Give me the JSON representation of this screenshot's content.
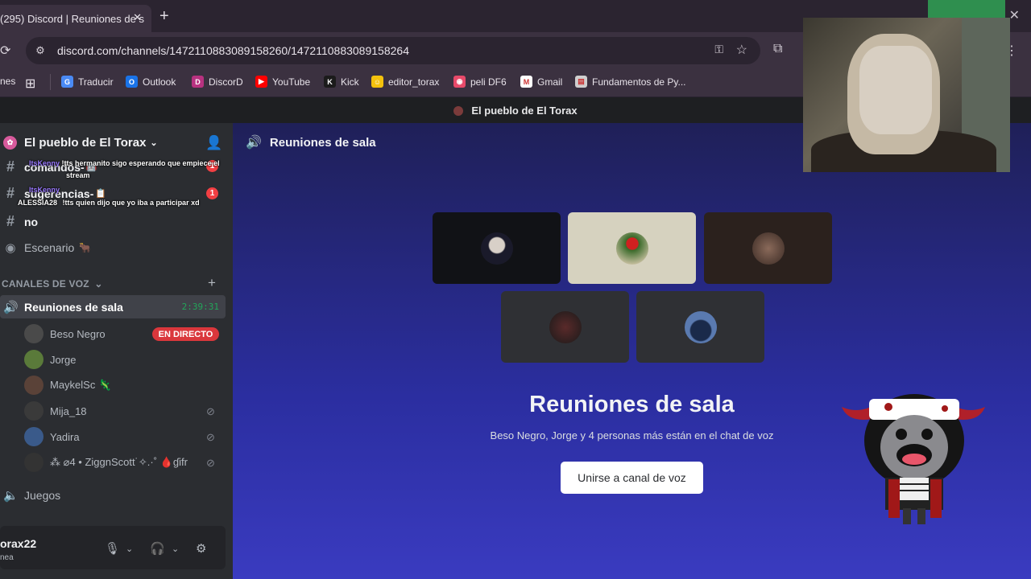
{
  "browser": {
    "tab_title": "(295) Discord | Reuniones de s",
    "tab_close": "✕",
    "new_tab": "+",
    "url": "discord.com/channels/1472110883089158260/1472110883089158264",
    "bookmarks": [
      {
        "label": "Traducir",
        "color": "#4a8af4",
        "glyph": "G"
      },
      {
        "label": "Outlook",
        "color": "#1a73e8",
        "glyph": "O"
      },
      {
        "label": "DiscorD",
        "color": "#b83280",
        "glyph": "D"
      },
      {
        "label": "YouTube",
        "color": "#ff0000",
        "glyph": "▶"
      },
      {
        "label": "Kick",
        "color": "#1b1b1b",
        "glyph": "K"
      },
      {
        "label": "editor_torax",
        "color": "#f4c20d",
        "glyph": "☺"
      },
      {
        "label": "peli DF6",
        "color": "#e84a6a",
        "glyph": "◉"
      },
      {
        "label": "Gmail",
        "color": "#ffffff",
        "glyph": "M"
      },
      {
        "label": "Fundamentos de Py...",
        "color": "#cfcfcf",
        "glyph": "▤"
      }
    ],
    "bookmark_left_fragment": "nes"
  },
  "discord": {
    "title_bar": "El pueblo de El Torax",
    "server_name": "El pueblo de El Torax",
    "channels": [
      {
        "name": "comandos-",
        "emoji": "🤖"
      },
      {
        "name": "sugerencias-",
        "emoji": "📋"
      },
      {
        "name": "no"
      },
      {
        "name": "Escenario",
        "emoji": "🐂"
      }
    ],
    "badges": [
      "1",
      "1"
    ],
    "overlay_chat": [
      {
        "nick": "ItsKenny",
        "text": "!tts hermanito sigo esperando que empiece el"
      },
      {
        "nick": "",
        "text": "stream"
      },
      {
        "nick": "ItsKenny",
        "text": ""
      },
      {
        "nick": "ALESSIA28",
        "text": "!tts quien dijo que yo iba a participar xd"
      }
    ],
    "voice_header": "CANALES DE VOZ",
    "voice_channel": {
      "name": "Reuniones de sala",
      "time": "2:39:31"
    },
    "members": [
      {
        "name": "Beso Negro",
        "live": "EN DIRECTO",
        "color": "#4a4a4a"
      },
      {
        "name": "Jorge",
        "color": "#5a7a3a"
      },
      {
        "name": "MaykelSc 🦎",
        "color": "#5a4238"
      },
      {
        "name": "Mija_18",
        "color": "#3a3a3a",
        "muted": true
      },
      {
        "name": "Yadira",
        "color": "#3a5a8a",
        "muted": true
      },
      {
        "name": "⁂ ⌀4 • ZiggnScott˙✧.·˚  🩸ɠifr",
        "color": "#333333",
        "muted": true
      }
    ],
    "other_channel": "Juegos",
    "user": {
      "name": "orax22",
      "status": "nea"
    },
    "main": {
      "header": "Reuniones de sala",
      "title": "Reuniones de sala",
      "subtitle": "Beso Negro, Jorge y 4 personas más están en el chat de voz",
      "join_button": "Unirse a canal de voz"
    }
  },
  "colors": {
    "accent_green": "#23a55a",
    "live_red": "#da373c",
    "badge_red": "#f23f43"
  }
}
